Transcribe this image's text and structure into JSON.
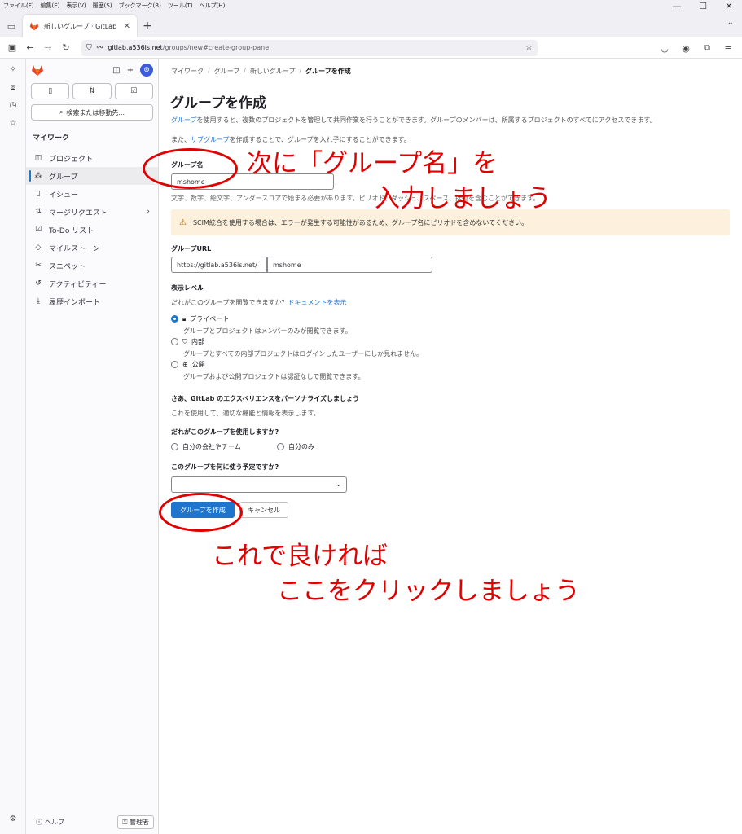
{
  "menubar": {
    "items": [
      "ファイル(F)",
      "編集(E)",
      "表示(V)",
      "履歴(S)",
      "ブックマーク(B)",
      "ツール(T)",
      "ヘルプ(H)"
    ]
  },
  "window_controls": {
    "minimize": "—",
    "maximize": "☐",
    "close": "✕"
  },
  "browser": {
    "tab_title": "新しいグループ · GitLab",
    "url_host": "gitlab.a536is.net",
    "url_path": "/groups/new#create-group-pane"
  },
  "sidebar": {
    "search_label": "検索または移動先...",
    "section_title": "マイワーク",
    "items": [
      {
        "label": "プロジェクト",
        "icon": "project-icon",
        "glyph": "◫"
      },
      {
        "label": "グループ",
        "icon": "group-icon",
        "glyph": "⁂",
        "active": true
      },
      {
        "label": "イシュー",
        "icon": "issue-icon",
        "glyph": "▯"
      },
      {
        "label": "マージリクエスト",
        "icon": "merge-request-icon",
        "glyph": "⇅",
        "chevron": "›"
      },
      {
        "label": "To-Do リスト",
        "icon": "todo-icon",
        "glyph": "☑"
      },
      {
        "label": "マイルストーン",
        "icon": "milestone-icon",
        "glyph": "◇"
      },
      {
        "label": "スニペット",
        "icon": "snippet-icon",
        "glyph": "✂"
      },
      {
        "label": "アクティビティー",
        "icon": "activity-icon",
        "glyph": "↺"
      },
      {
        "label": "履歴インポート",
        "icon": "import-icon",
        "glyph": "⤓"
      }
    ],
    "help_label": "ヘルプ",
    "admin_label": "管理者"
  },
  "breadcrumb": [
    "マイワーク",
    "グループ",
    "新しいグループ",
    "グループを作成"
  ],
  "page": {
    "title": "グループを作成",
    "intro1_link": "グループ",
    "intro1_rest": "を使用すると、複数のプロジェクトを管理して共同作業を行うことができます。グループのメンバーは、所属するプロジェクトのすべてにアクセスできます。",
    "intro2_pre": "また、",
    "intro2_link": "サブグループ",
    "intro2_rest": "を作成することで、グループを入れ子にすることができます。",
    "group_name_label": "グループ名",
    "group_name_value": "mshome",
    "group_name_help": "文字、数字、絵文字、アンダースコアで始まる必要があります。ピリオド、ダッシュ、スペース、括弧を含むことができます。",
    "alert_text": "SCIM統合を使用する場合は、エラーが発生する可能性があるため、グループ名にピリオドを含めないでください。",
    "group_url_label": "グループURL",
    "group_url_prefix": "https://gitlab.a536is.net/",
    "group_url_value": "mshome",
    "visibility_label": "表示レベル",
    "visibility_question": "だれがこのグループを閲覧できますか？",
    "visibility_doc_link": "ドキュメントを表示",
    "visibility_options": [
      {
        "label": "プライベート",
        "icon": "lock-icon",
        "glyph": "🔒︎",
        "desc": "グループとプロジェクトはメンバーのみが閲覧できます。",
        "selected": true
      },
      {
        "label": "内部",
        "icon": "shield-icon",
        "glyph": "⛉",
        "desc": "グループとすべての内部プロジェクトはログインしたユーザーにしか見れません。",
        "selected": false
      },
      {
        "label": "公開",
        "icon": "globe-icon",
        "glyph": "⊕",
        "desc": "グループおよび公開プロジェクトは認証なしで閲覧できます。",
        "selected": false
      }
    ],
    "personalize_title": "さあ、GitLab のエクスペリエンスをパーソナライズしましょう",
    "personalize_desc": "これを使用して、適切な機能と情報を表示します。",
    "who_uses_label": "だれがこのグループを使用しますか?",
    "who_uses_options": [
      "自分の会社やチーム",
      "自分のみ"
    ],
    "purpose_label": "このグループを何に使う予定ですか?",
    "purpose_value": "",
    "create_button": "グループを作成",
    "cancel_button": "キャンセル"
  },
  "annotations": {
    "text1_line1": "次に「グループ名」を",
    "text1_line2": "入力しましょう",
    "text2_line1": "これで良ければ",
    "text2_line2": "ここをクリックしましょう",
    "color": "#e00000"
  },
  "colors": {
    "primary": "#1f75cb",
    "alert_bg": "#fdf1dd",
    "gitlab_orange": "#e24329"
  }
}
